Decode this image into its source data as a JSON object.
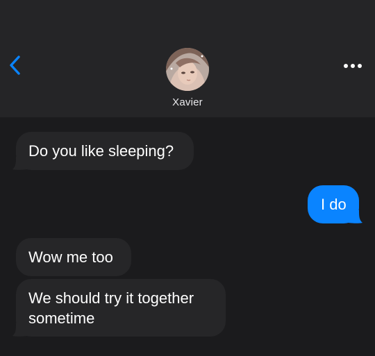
{
  "header": {
    "contact_name": "Xavier",
    "back_icon": "chevron-left-icon",
    "more_icon": "ellipsis-icon",
    "accent_color": "#0a84ff"
  },
  "messages": [
    {
      "direction": "incoming",
      "text": "Do you like sleeping?"
    },
    {
      "direction": "outgoing",
      "text": "I do"
    },
    {
      "direction": "incoming",
      "text": "Wow me too"
    },
    {
      "direction": "incoming",
      "lines": [
        "We should try it together",
        "sometime"
      ]
    }
  ],
  "colors": {
    "background": "#1b1b1d",
    "header_background": "#252527",
    "incoming_bubble": "#262628",
    "outgoing_bubble": "#0a84ff",
    "text": "#ffffff"
  }
}
